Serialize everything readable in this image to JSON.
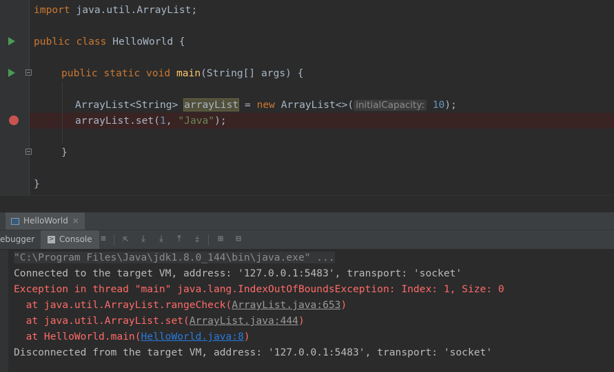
{
  "editor": {
    "line_import_kw": "import",
    "line_import_rest": " java.util.ArrayList;",
    "class_public": "public",
    "class_kw": "class",
    "class_rest": " HelloWorld {",
    "main_public": "public",
    "main_static": "static",
    "main_void": "void",
    "main_name": "main",
    "main_rest": "(String[] args) {",
    "decl_type": "ArrayList<String> ",
    "decl_var": "arrayList",
    "decl_eq": " = ",
    "decl_new": "new",
    "decl_ctor": " ArrayList<>(",
    "hint_label": "initialCapacity:",
    "decl_num": "10",
    "decl_end": ");",
    "set_prefix": "arrayList.set(",
    "set_num": "1",
    "set_comma": ", ",
    "set_str": "\"Java\"",
    "set_end": ");",
    "close_inner": "}",
    "close_outer": "}"
  },
  "run_panel": {
    "tab_label": "HelloWorld",
    "tab_close": "×",
    "debugger_label": "ebugger",
    "console_label": "Console"
  },
  "console": {
    "cmd": "\"C:\\Program Files\\Java\\jdk1.8.0_144\\bin\\java.exe\" ...",
    "connected": "Connected to the target VM, address: '127.0.0.1:5483', transport: 'socket'",
    "exception": "Exception in thread \"main\" java.lang.IndexOutOfBoundsException: Index: 1, Size: 0",
    "trace1_prefix": "  at java.util.ArrayList.rangeCheck(",
    "trace1_link": "ArrayList.java:653",
    "trace1_suffix": ")",
    "trace2_prefix": "  at java.util.ArrayList.set(",
    "trace2_link": "ArrayList.java:444",
    "trace2_suffix": ")",
    "trace3_prefix": "  at HelloWorld.main(",
    "trace3_link": "HelloWorld.java:8",
    "trace3_suffix": ")",
    "disconnected": "Disconnected from the target VM, address: '127.0.0.1:5483', transport: 'socket'"
  },
  "colors": {
    "keyword": "#cc7832",
    "function": "#ffc66d",
    "number": "#6897bb",
    "string": "#6a8759",
    "error": "#ff6b68",
    "link": "#287bde",
    "breakpoint": "#c75450",
    "run": "#499c54"
  }
}
